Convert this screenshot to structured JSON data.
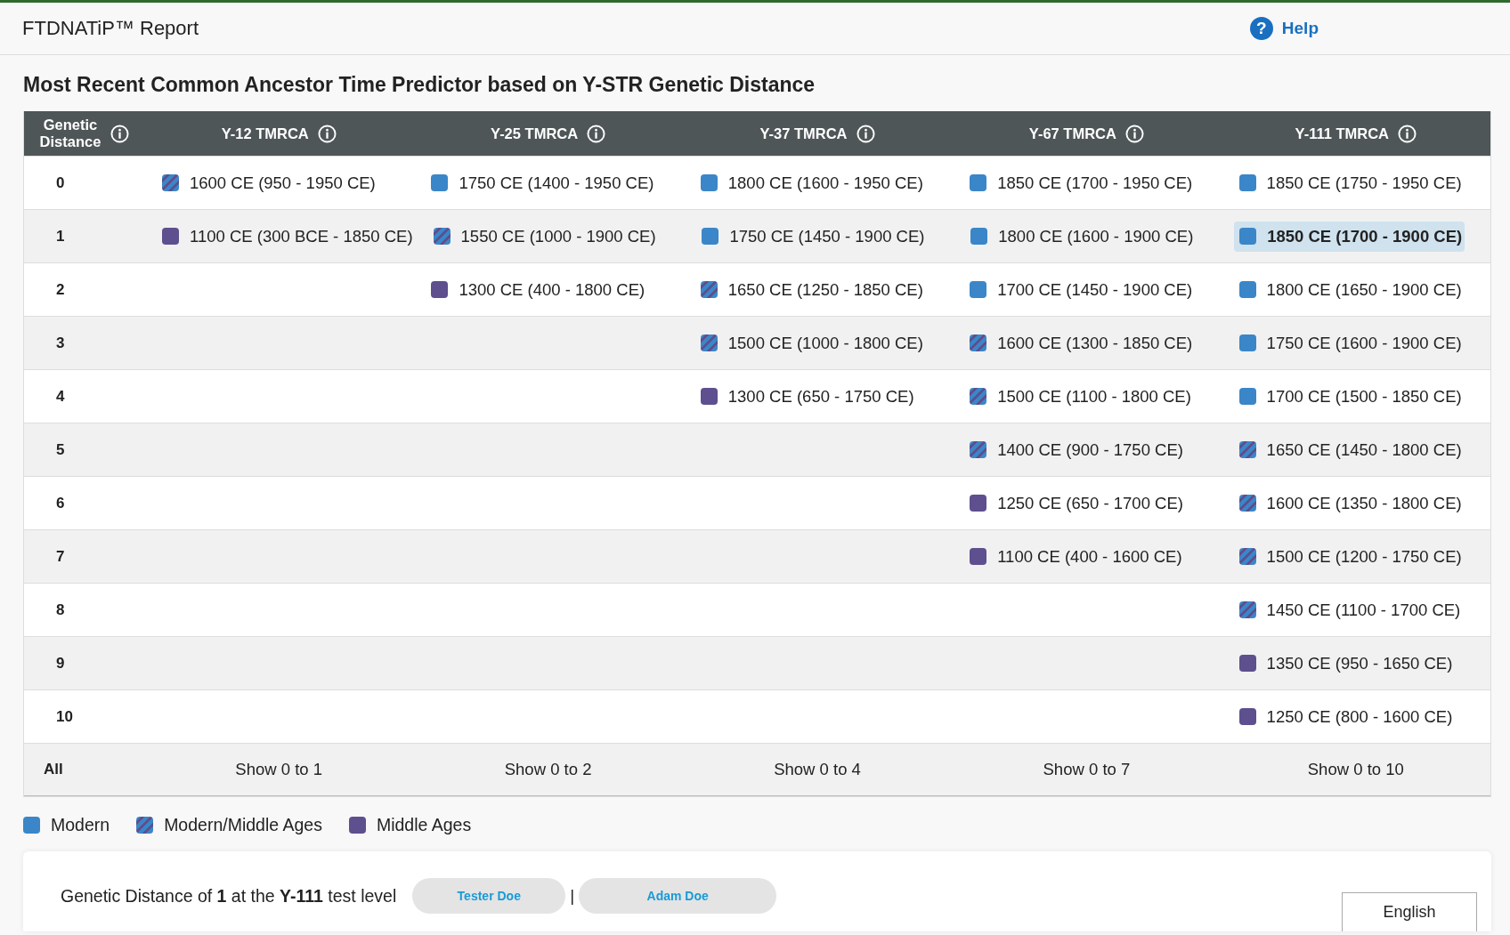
{
  "header": {
    "title": "FTDNATiP™ Report",
    "help_icon": "?",
    "help": "Help"
  },
  "heading": "Most Recent Common Ancestor Time Predictor based on Y-STR Genetic Distance",
  "table": {
    "columns": [
      "Genetic Distance",
      "Y-12 TMRCA",
      "Y-25 TMRCA",
      "Y-37 TMRCA",
      "Y-67 TMRCA",
      "Y-111 TMRCA"
    ],
    "rows": [
      {
        "cells": [
          "0",
          {
            "kind": "mixed",
            "text": "1600 CE (950 - 1950 CE)",
            "selected": false
          },
          {
            "kind": "modern",
            "text": "1750 CE (1400 - 1950 CE)",
            "selected": false
          },
          {
            "kind": "modern",
            "text": "1800 CE (1600 - 1950 CE)",
            "selected": false
          },
          {
            "kind": "modern",
            "text": "1850 CE (1700 - 1950 CE)",
            "selected": false
          },
          {
            "kind": "modern",
            "text": "1850 CE (1750 - 1950 CE)",
            "selected": false
          }
        ]
      },
      {
        "cells": [
          "1",
          {
            "kind": "middle",
            "text": "1100 CE (300 BCE - 1850 CE)",
            "selected": false
          },
          {
            "kind": "mixed",
            "text": "1550 CE (1000 - 1900 CE)",
            "selected": false
          },
          {
            "kind": "modern",
            "text": "1750 CE (1450 - 1900 CE)",
            "selected": false
          },
          {
            "kind": "modern",
            "text": "1800 CE (1600 - 1900 CE)",
            "selected": false
          },
          {
            "kind": "modern",
            "text": "1850 CE (1700 - 1900 CE)",
            "selected": true
          }
        ]
      },
      {
        "cells": [
          "2",
          "",
          {
            "kind": "middle",
            "text": "1300 CE (400 - 1800 CE)",
            "selected": false
          },
          {
            "kind": "mixed",
            "text": "1650 CE (1250 - 1850 CE)",
            "selected": false
          },
          {
            "kind": "modern",
            "text": "1700 CE (1450 - 1900 CE)",
            "selected": false
          },
          {
            "kind": "modern",
            "text": "1800 CE (1650 - 1900 CE)",
            "selected": false
          }
        ]
      },
      {
        "cells": [
          "3",
          "",
          "",
          {
            "kind": "mixed",
            "text": "1500 CE (1000 - 1800 CE)",
            "selected": false
          },
          {
            "kind": "mixed",
            "text": "1600 CE (1300 - 1850 CE)",
            "selected": false
          },
          {
            "kind": "modern",
            "text": "1750 CE (1600 - 1900 CE)",
            "selected": false
          }
        ]
      },
      {
        "cells": [
          "4",
          "",
          "",
          {
            "kind": "middle",
            "text": "1300 CE (650 - 1750 CE)",
            "selected": false
          },
          {
            "kind": "mixed",
            "text": "1500 CE (1100 - 1800 CE)",
            "selected": false
          },
          {
            "kind": "modern",
            "text": "1700 CE (1500 - 1850 CE)",
            "selected": false
          }
        ]
      },
      {
        "cells": [
          "5",
          "",
          "",
          "",
          {
            "kind": "mixed",
            "text": "1400 CE (900 - 1750 CE)",
            "selected": false
          },
          {
            "kind": "mixed",
            "text": "1650 CE (1450 - 1800 CE)",
            "selected": false
          }
        ]
      },
      {
        "cells": [
          "6",
          "",
          "",
          "",
          {
            "kind": "middle",
            "text": "1250 CE (650 - 1700 CE)",
            "selected": false
          },
          {
            "kind": "mixed",
            "text": "1600 CE (1350 - 1800 CE)",
            "selected": false
          }
        ]
      },
      {
        "cells": [
          "7",
          "",
          "",
          "",
          {
            "kind": "middle",
            "text": "1100 CE (400 - 1600 CE)",
            "selected": false
          },
          {
            "kind": "mixed",
            "text": "1500 CE (1200 - 1750 CE)",
            "selected": false
          }
        ]
      },
      {
        "cells": [
          "8",
          "",
          "",
          "",
          "",
          {
            "kind": "mixed",
            "text": "1450 CE (1100 - 1700 CE)",
            "selected": false
          }
        ]
      },
      {
        "cells": [
          "9",
          "",
          "",
          "",
          "",
          {
            "kind": "middle",
            "text": "1350 CE (950 - 1650 CE)",
            "selected": false
          }
        ]
      },
      {
        "cells": [
          "10",
          "",
          "",
          "",
          "",
          {
            "kind": "middle",
            "text": "1250 CE (800 - 1600 CE)",
            "selected": false
          }
        ]
      },
      {
        "cells": [
          "All",
          "Show 0 to 1",
          "Show 0 to 2",
          "Show 0 to 4",
          "Show 0 to 7",
          "Show 0 to 10"
        ]
      }
    ]
  },
  "legend": [
    {
      "kind": "modern",
      "label": "Modern"
    },
    {
      "kind": "mixed",
      "label": "Modern/Middle Ages"
    },
    {
      "kind": "middle",
      "label": "Middle Ages"
    }
  ],
  "detail": {
    "sentence": "Genetic Distance of **1** at the **Y-111** test level",
    "people": [
      "Tester Doe",
      "Adam Doe"
    ],
    "separator": "|",
    "language": "English"
  }
}
